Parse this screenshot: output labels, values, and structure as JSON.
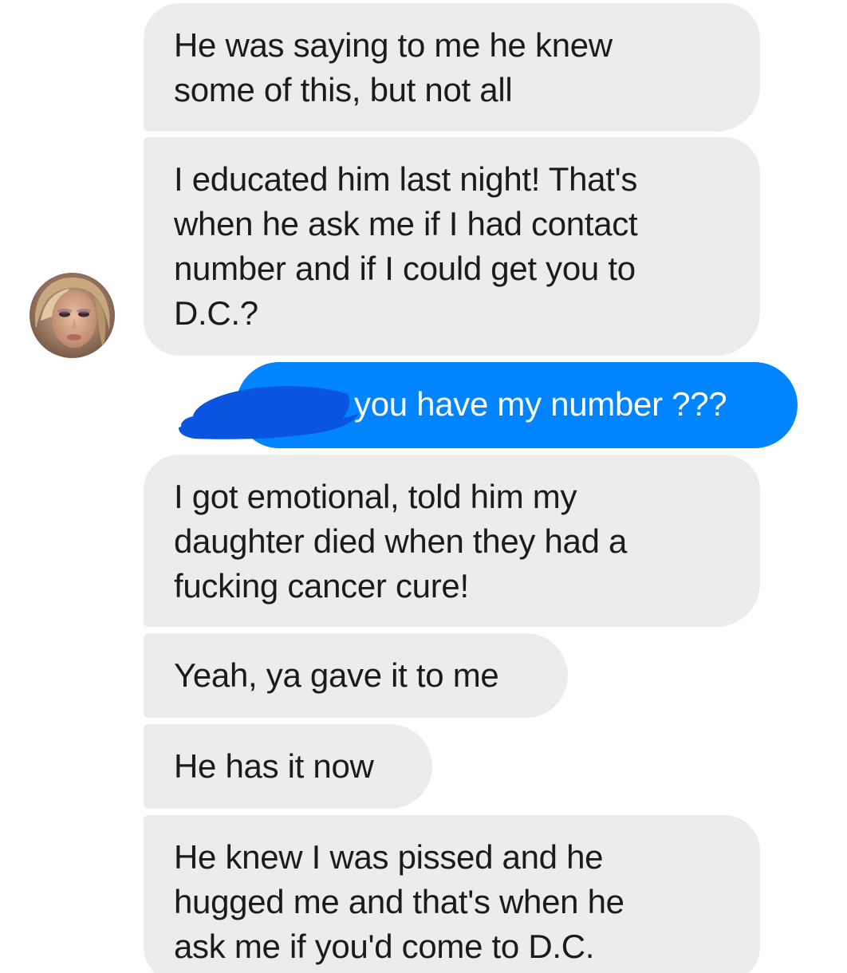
{
  "conversation": {
    "messages": [
      {
        "sender": "contact",
        "text": "He was saying to me he knew\nsome of this, but not all"
      },
      {
        "sender": "contact",
        "text": "I educated him last night! That's\nwhen he ask me if I had contact\nnumber and if I could get you to\nD.C.?"
      },
      {
        "sender": "me",
        "text": "you have my number ???",
        "redacted_prefix": true
      },
      {
        "sender": "contact",
        "text": "I got emotional, told him my\ndaughter died when they had a\nfucking cancer cure!"
      },
      {
        "sender": "contact",
        "text": "Yeah, ya gave it to me"
      },
      {
        "sender": "contact",
        "text": "He has it now"
      },
      {
        "sender": "contact",
        "text": "He knew I was pissed and he\nhugged me and that's when he\nask me if you'd come to D.C."
      }
    ]
  },
  "colors": {
    "incoming_bubble": "#ececec",
    "outgoing_bubble": "#0084ff",
    "outgoing_text": "#ffffff",
    "incoming_text": "#1b1b1b",
    "redaction": "#0a55e0"
  },
  "icons": {
    "contact_avatar": "contact-avatar-photo"
  }
}
